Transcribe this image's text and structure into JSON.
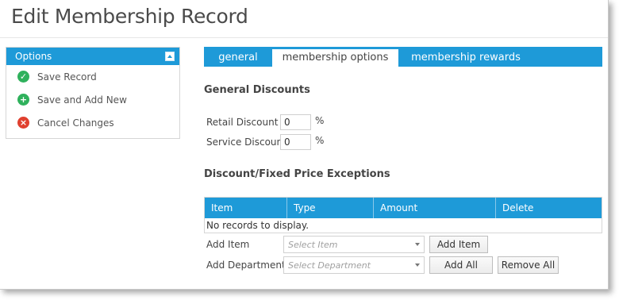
{
  "page": {
    "title": "Edit Membership Record"
  },
  "options": {
    "header": "Options",
    "items": [
      {
        "label": "Save Record",
        "icon": "check-circle-icon"
      },
      {
        "label": "Save and Add New",
        "icon": "plus-circle-icon"
      },
      {
        "label": "Cancel Changes",
        "icon": "x-circle-icon"
      }
    ]
  },
  "tabs": [
    {
      "label": "general",
      "active": false
    },
    {
      "label": "membership options",
      "active": true
    },
    {
      "label": "membership rewards",
      "active": false
    }
  ],
  "general_discounts": {
    "title": "General Discounts",
    "retail_label": "Retail Discount",
    "retail_value": "0",
    "service_label": "Service Discount",
    "service_value": "0",
    "unit": "%"
  },
  "exceptions": {
    "title": "Discount/Fixed Price Exceptions",
    "columns": [
      "Item",
      "Type",
      "Amount",
      "Delete"
    ],
    "empty_message": "No records to display.",
    "add_item_label": "Add Item",
    "select_item_placeholder": "Select Item",
    "add_item_button": "Add Item",
    "add_department_label": "Add Department:",
    "select_department_placeholder": "Select Department",
    "add_all_button": "Add All",
    "remove_all_button": "Remove All"
  },
  "colors": {
    "accent": "#1e9ad8",
    "success": "#2fb15c",
    "danger": "#e0402f"
  }
}
